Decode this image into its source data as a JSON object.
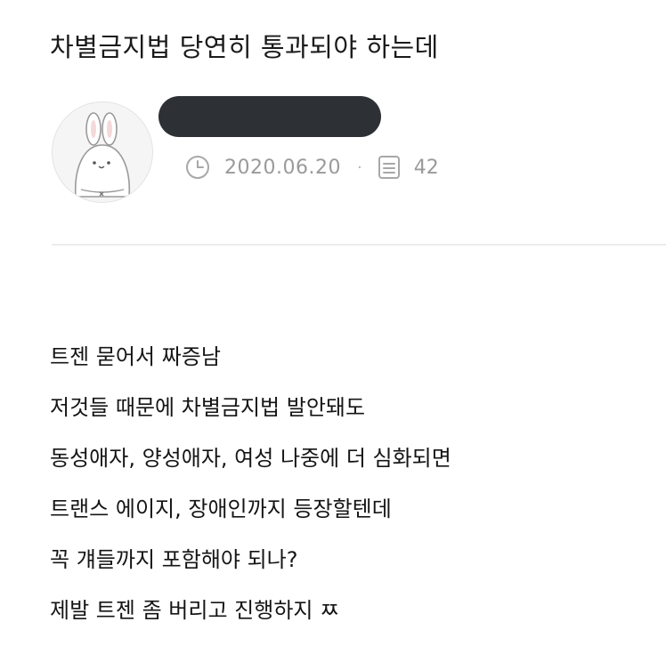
{
  "post": {
    "title": "차별금지법 당연히 통과되야 하는데",
    "date": "2020.06.20",
    "separator": "·",
    "views": "42",
    "body_lines": [
      "트젠 묻어서 짜증남",
      "저것들 때문에 차별금지법 발안돼도",
      "동성애자, 양성애자, 여성 나중에 더 심화되면",
      "트랜스 에이지, 장애인까지 등장할텐데",
      "꼭 걔들까지 포함해야 되나?",
      "제발 트젠 좀 버리고 진행하지 ㅉ"
    ]
  },
  "icons": {
    "avatar": "bunny-avatar-icon",
    "date": "clock-icon",
    "views": "document-icon"
  },
  "colors": {
    "redaction": "#2d3034",
    "meta_text": "#9a9a9a",
    "divider": "#ececec"
  }
}
